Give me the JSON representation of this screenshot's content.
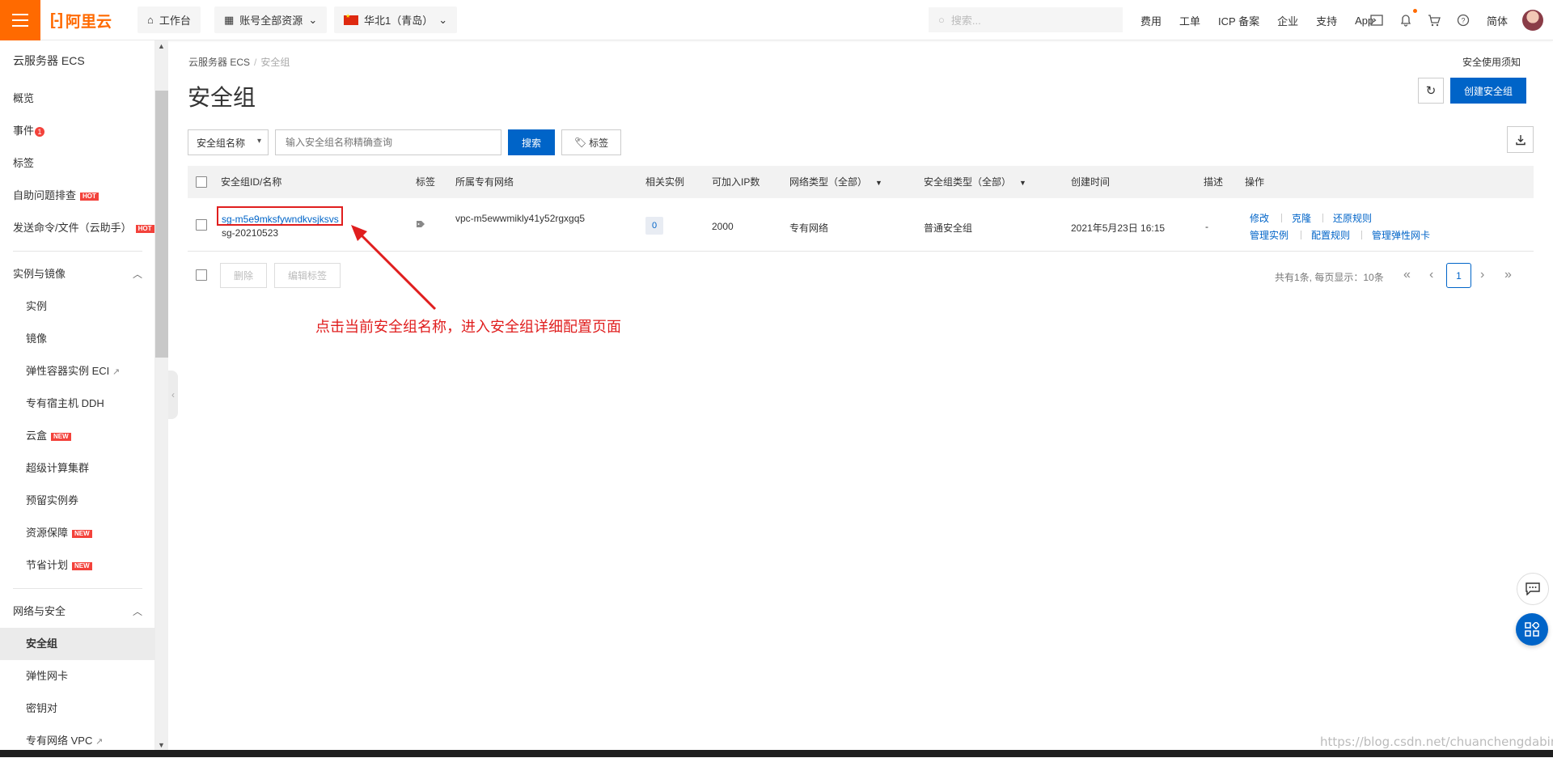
{
  "topbar": {
    "logo_text": "阿里云",
    "workbench": "工作台",
    "resources": "账号全部资源",
    "region": "华北1（青岛）",
    "search_placeholder": "搜索...",
    "nav": [
      "费用",
      "工单",
      "ICP 备案",
      "企业",
      "支持",
      "App"
    ],
    "language": "简体",
    "icons": [
      "terminal-icon",
      "bell-icon",
      "cart-icon",
      "help-icon"
    ],
    "accent_color": "#ff6a00"
  },
  "sidebar": {
    "title": "云服务器 ECS",
    "items": [
      {
        "label": "概览"
      },
      {
        "label": "事件",
        "badge": "1"
      },
      {
        "label": "标签"
      },
      {
        "label": "自助问题排查",
        "tag": "HOT"
      },
      {
        "label": "发送命令/文件（云助手）",
        "tag": "HOT"
      }
    ],
    "group1": {
      "label": "实例与镜像",
      "items": [
        {
          "label": "实例"
        },
        {
          "label": "镜像"
        },
        {
          "label": "弹性容器实例 ECI"
        },
        {
          "label": "专有宿主机 DDH"
        },
        {
          "label": "云盒",
          "tag": "NEW"
        },
        {
          "label": "超级计算集群"
        },
        {
          "label": "预留实例券"
        },
        {
          "label": "资源保障",
          "tag": "NEW"
        },
        {
          "label": "节省计划",
          "tag": "NEW"
        }
      ]
    },
    "group2": {
      "label": "网络与安全",
      "items": [
        {
          "label": "安全组",
          "active": true
        },
        {
          "label": "弹性网卡"
        },
        {
          "label": "密钥对"
        },
        {
          "label": "专有网络 VPC"
        }
      ]
    }
  },
  "page": {
    "breadcrumb": [
      "云服务器 ECS",
      "安全组"
    ],
    "title": "安全组",
    "notice_link": "安全使用须知",
    "create_button": "创建安全组"
  },
  "filter": {
    "select_value": "安全组名称",
    "input_placeholder": "输入安全组名称精确查询",
    "search_button": "搜索",
    "tag_button": "标签"
  },
  "table": {
    "headers": [
      "安全组ID/名称",
      "标签",
      "所属专有网络",
      "相关实例",
      "可加入IP数",
      "网络类型（全部）",
      "安全组类型（全部）",
      "创建时间",
      "描述",
      "操作"
    ],
    "rows": [
      {
        "id": "sg-m5e9mksfywndkvsjksvs",
        "name": "sg-20210523",
        "vpc": "vpc-m5ewwmikly41y52rgxgq5",
        "instances": "0",
        "ip_count": "2000",
        "network_type": "专有网络",
        "sg_type": "普通安全组",
        "created": "2021年5月23日 16:15",
        "description": "-",
        "actions_row1": [
          "修改",
          "克隆",
          "还原规则"
        ],
        "actions_row2": [
          "管理实例",
          "配置规则",
          "管理弹性网卡"
        ]
      }
    ]
  },
  "bottom": {
    "delete_button": "删除",
    "edit_tags_button": "编辑标签",
    "pager_info": "共有1条, 每页显示：10条",
    "current_page": "1"
  },
  "annotation": {
    "text": "点击当前安全组名称，进入安全组详细配置页面",
    "color": "#e01e1e"
  },
  "watermark": "https://blog.csdn.net/chuanchengdabing"
}
